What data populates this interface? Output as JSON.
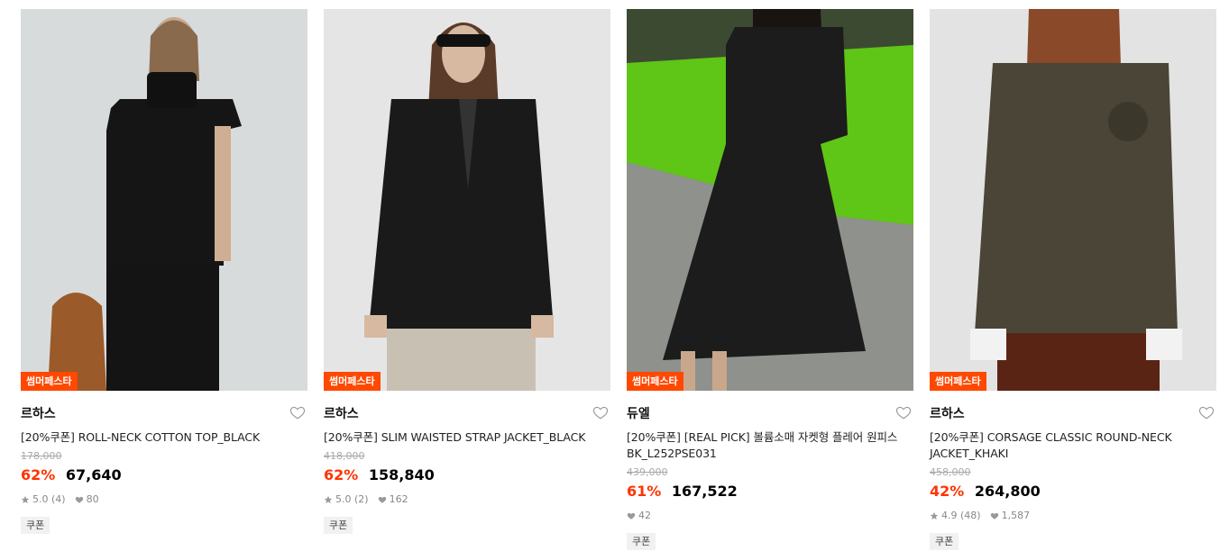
{
  "products": [
    {
      "badge": "썸머페스타",
      "brand": "르하스",
      "title": "[20%쿠폰] ROLL-NECK COTTON TOP_BLACK",
      "original_price": "178,000",
      "discount": "62%",
      "price": "67,640",
      "rating": "5.0 (4)",
      "likes": "80",
      "tag": "쿠폰",
      "colors": {
        "bg": "#d8dbdc",
        "garment": "#151515"
      }
    },
    {
      "badge": "썸머페스타",
      "brand": "르하스",
      "title": "[20%쿠폰] SLIM WAISTED STRAP JACKET_BLACK",
      "original_price": "418,000",
      "discount": "62%",
      "price": "158,840",
      "rating": "5.0 (2)",
      "likes": "162",
      "tag": "쿠폰",
      "colors": {
        "bg": "#e5e5e5",
        "garment": "#1a1a1a"
      }
    },
    {
      "badge": "썸머페스타",
      "brand": "듀엘",
      "title": "[20%쿠폰] [REAL PICK] 볼륨소매 자켓형 플레어 원피스 BK_L252PSE031",
      "original_price": "439,000",
      "discount": "61%",
      "price": "167,522",
      "rating": "",
      "likes": "42",
      "tag": "쿠폰",
      "colors": {
        "bg": "#7a7d77",
        "garment": "#1c1c1c"
      }
    },
    {
      "badge": "썸머페스타",
      "brand": "르하스",
      "title": "[20%쿠폰] CORSAGE CLASSIC ROUND-NECK JACKET_KHAKI",
      "original_price": "458,000",
      "discount": "42%",
      "price": "264,800",
      "rating": "4.9 (48)",
      "likes": "1,587",
      "tag": "쿠폰",
      "colors": {
        "bg": "#e3e3e3",
        "garment": "#4a4536"
      }
    }
  ]
}
